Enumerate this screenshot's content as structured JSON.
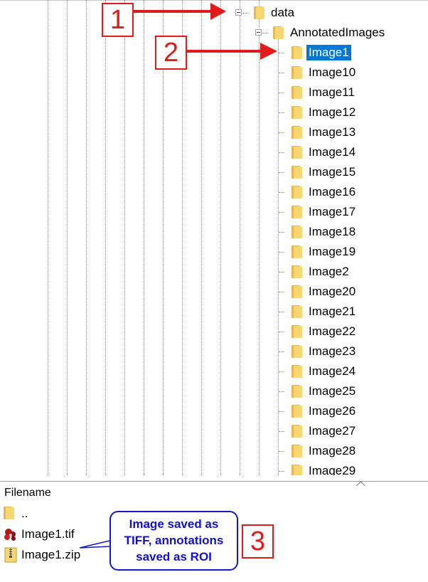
{
  "tree": {
    "root": "data",
    "child": "AnnotatedImages",
    "items": [
      "Image1",
      "Image10",
      "Image11",
      "Image12",
      "Image13",
      "Image14",
      "Image15",
      "Image16",
      "Image17",
      "Image18",
      "Image19",
      "Image2",
      "Image20",
      "Image21",
      "Image22",
      "Image23",
      "Image24",
      "Image25",
      "Image26",
      "Image27",
      "Image28",
      "Image29"
    ],
    "selected": "Image1"
  },
  "files": {
    "header": "Filename",
    "rows": [
      {
        "name": "..",
        "icon": "folder-icon"
      },
      {
        "name": "Image1.tif",
        "icon": "tif-image-icon"
      },
      {
        "name": "Image1.zip",
        "icon": "zip-archive-icon"
      }
    ]
  },
  "annotations": {
    "marker1": "1",
    "marker2": "2",
    "marker3": "3",
    "callout_lines": [
      "Image saved as",
      "TIFF, annotations",
      "saved as ROI"
    ],
    "colors": {
      "marker": "#e01b1b",
      "callout": "#1717c8",
      "selection": "#0078d7",
      "folder": "#f7d774"
    }
  }
}
